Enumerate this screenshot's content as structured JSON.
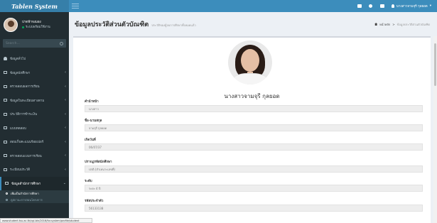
{
  "app": {
    "logo": "Tablen System"
  },
  "user_panel": {
    "name": "บ่าดฟ้าจงมอง",
    "status": "ระบบพร้อมใช้งาน"
  },
  "search": {
    "placeholder": "Search..."
  },
  "sidebar": {
    "items": [
      {
        "label": "ข้อมูลทั่วไป"
      },
      {
        "label": "ข้อมูลนักศึกษา"
      },
      {
        "label": "ตรวจสอบผลการเรียน"
      },
      {
        "label": "ข้อมูลในทะเบียนทางตาม"
      },
      {
        "label": "ประวัติการชำระเงิน"
      },
      {
        "label": "แบบทดสอบ"
      },
      {
        "label": "สอบเก็บคะแนนร้อยเปอร์"
      },
      {
        "label": "ตรวจสอบแบบการเรียน"
      },
      {
        "label": "ระเบียนประวัติ"
      },
      {
        "label": "ข้อมูลสำนักการศึกษา"
      }
    ],
    "submenu": [
      {
        "label": "เพิ่มเป็นสำนักการศึกษา"
      },
      {
        "label": "ดูสถานะการสอนโครงการ"
      }
    ]
  },
  "navbar": {
    "badges": [
      {
        "value": "",
        "color": "#00a65a"
      },
      {
        "value": "",
        "color": "#f39c12"
      },
      {
        "value": "",
        "color": "#dd4b39"
      }
    ],
    "user_label": "นางสาวจามจุรี กุลยอด"
  },
  "header": {
    "title": "ข้อมูลประวัติส่วนตัวบัณฑิต",
    "subtitle": "ประวัติของผู้จบการศึกษาทั้งหมดแล้ว",
    "breadcrumb_home": "หน้าหลัก",
    "breadcrumb_current": "ข้อมูลประวัติส่วนตัวบัณฑิต"
  },
  "profile": {
    "full_name": "นางสาวจามจุรี กุลยอด"
  },
  "fields": [
    {
      "label": "คำนำหน้า",
      "value": "นางสาว"
    },
    {
      "label": "ชื่อ-นามสกุล",
      "value": "จามจุรี กุลยอด"
    },
    {
      "label": "เกิดวันที่",
      "value": "06/07/37"
    },
    {
      "label": "ปรากฏรหัสนักศึกษา",
      "value": "ปกติ (สำเหนาะเลขที่)"
    },
    {
      "label": "ระดับ",
      "value": "ระยะ 4 ปี"
    },
    {
      "label": "รหัสประจำตัว",
      "value": "56133138"
    }
  ],
  "statusbar": {
    "url": "www.student.tsu.ac.th/cgi-bin/2016/for.system/profile/student"
  }
}
